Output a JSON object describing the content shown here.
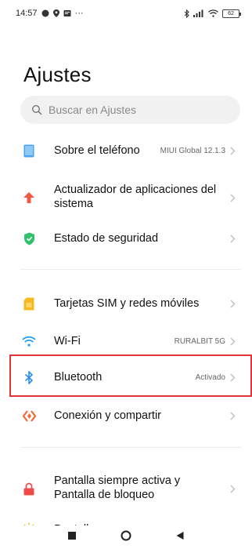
{
  "status_bar": {
    "time": "14:57",
    "more": "···",
    "battery": "62"
  },
  "header": {
    "title": "Ajustes"
  },
  "search": {
    "placeholder": "Buscar en Ajustes"
  },
  "settings": {
    "items": [
      {
        "label": "Sobre el teléfono",
        "value": "MIUI Global 12.1.3",
        "icon": "phone-icon",
        "color": "#4aa3f0"
      },
      {
        "label": "Actualizador de aplicaciones del sistema",
        "value": "",
        "icon": "arrow-up-icon",
        "color": "#f2573f"
      },
      {
        "label": "Estado de seguridad",
        "value": "",
        "icon": "shield-check-icon",
        "color": "#2fc26b"
      },
      {
        "label": "Tarjetas SIM y redes móviles",
        "value": "",
        "icon": "sim-card-icon",
        "color": "#f5b921"
      },
      {
        "label": "Wi-Fi",
        "value": "RURALBIT 5G",
        "icon": "wifi-icon",
        "color": "#1f9cf0"
      },
      {
        "label": "Bluetooth",
        "value": "Activado",
        "icon": "bluetooth-icon",
        "color": "#2a8ee8"
      },
      {
        "label": "Conexión y compartir",
        "value": "",
        "icon": "connection-share-icon",
        "color": "#f06a3a"
      },
      {
        "label": "Pantalla siempre activa y Pantalla de bloqueo",
        "value": "",
        "icon": "lock-icon",
        "color": "#f04b4b"
      },
      {
        "label": "Pantalla",
        "value": "",
        "icon": "sun-icon",
        "color": "#f5c02a"
      }
    ]
  }
}
